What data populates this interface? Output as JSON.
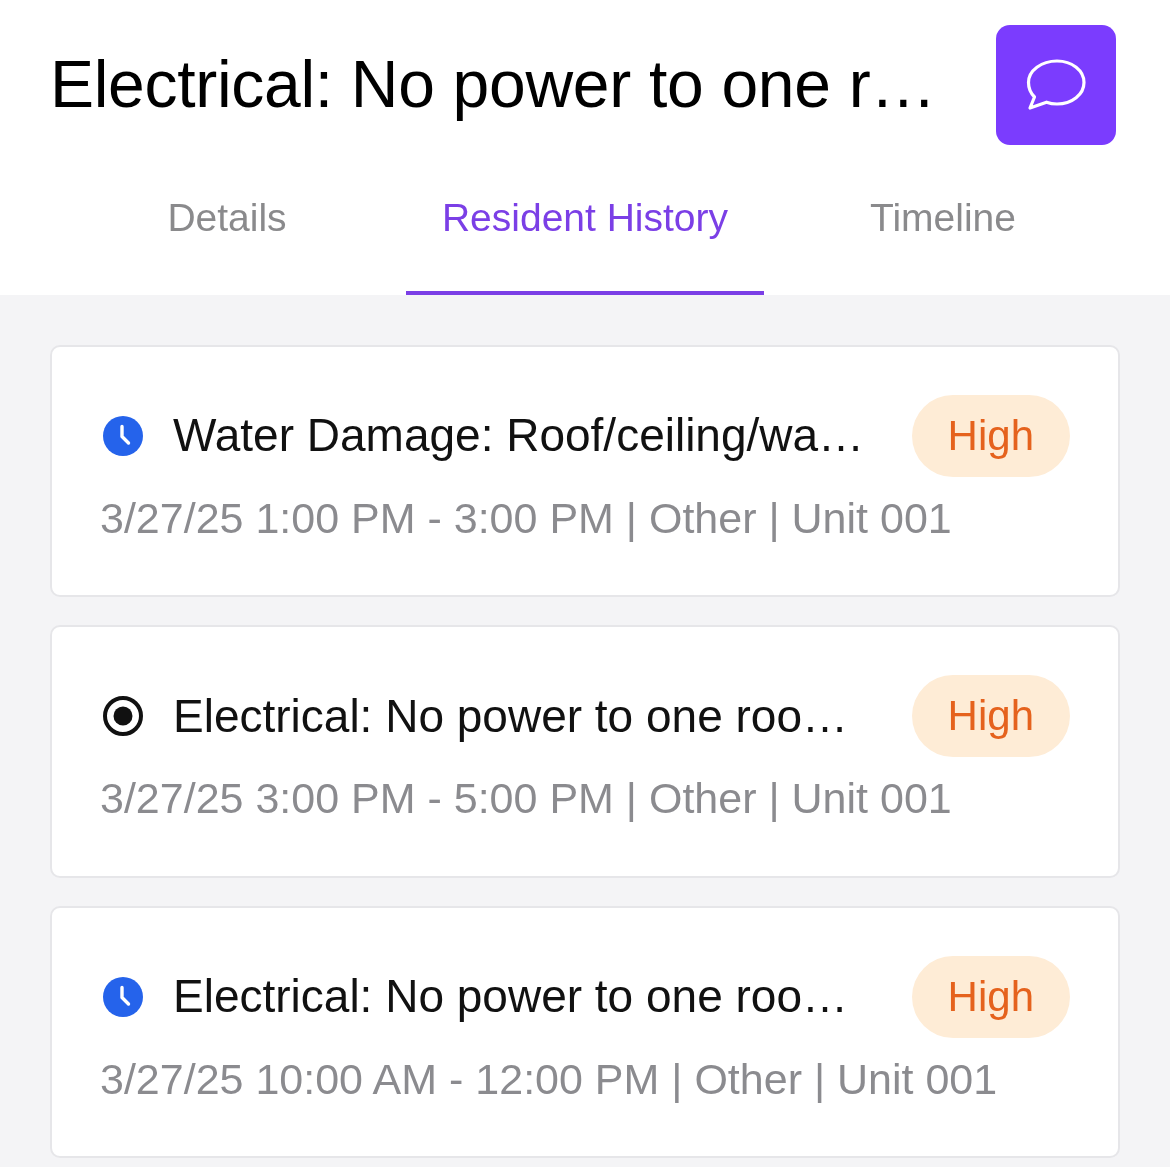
{
  "header": {
    "title": "Electrical: No power to one r…"
  },
  "tabs": [
    {
      "label": "Details",
      "selected": false
    },
    {
      "label": "Resident History",
      "selected": true
    },
    {
      "label": "Timeline",
      "selected": false
    }
  ],
  "tickets": [
    {
      "kind": "clock",
      "title": "Water Damage: Roof/ceiling/wa…",
      "priority": "High",
      "details": "3/27/25 1:00 PM - 3:00 PM | Other | Unit 001"
    },
    {
      "kind": "dot",
      "title": "Electrical: No power to one roo…",
      "priority": "High",
      "details": "3/27/25 3:00 PM - 5:00 PM | Other | Unit 001"
    },
    {
      "kind": "clock",
      "title": "Electrical: No power to one roo…",
      "priority": "High",
      "details": "3/27/25 10:00 AM - 12:00 PM | Other | Unit 001"
    }
  ]
}
